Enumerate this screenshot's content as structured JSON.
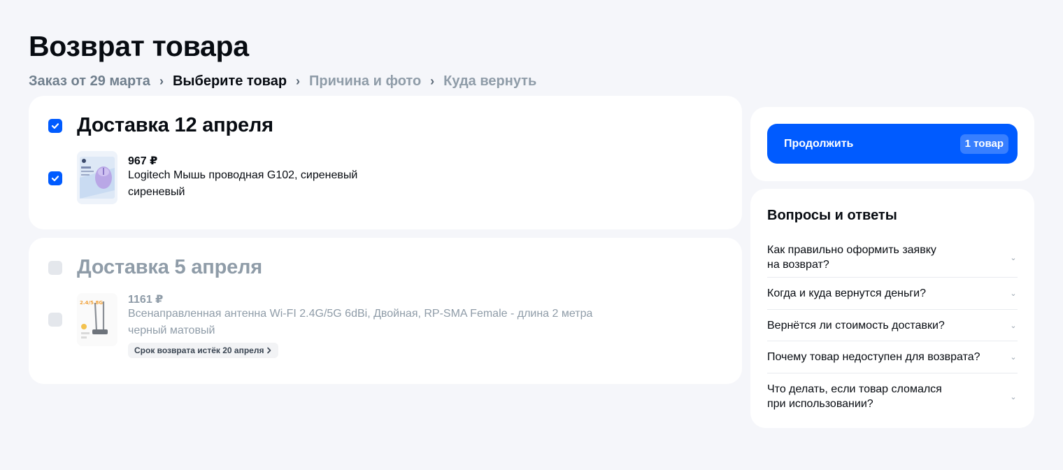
{
  "page": {
    "title": "Возврат товара"
  },
  "breadcrumb": [
    {
      "label": "Заказ от 29 марта",
      "state": "done"
    },
    {
      "label": "Выберите товар",
      "state": "active"
    },
    {
      "label": "Причина и фото",
      "state": "future"
    },
    {
      "label": "Куда вернуть",
      "state": "future"
    }
  ],
  "breadcrumb_separator": "›",
  "groups": [
    {
      "title": "Доставка 12 апреля",
      "checked": true,
      "item": {
        "price": "967 ₽",
        "name": "Logitech Мышь проводная G102, сиреневый",
        "color": "сиреневый",
        "checked": true
      }
    },
    {
      "title": "Доставка 5 апреля",
      "checked": false,
      "item": {
        "price": "1161 ₽",
        "name": "Всенаправленная антенна Wi-FI 2.4G/5G 6dBi, Двойная, RP-SMA Female - длина 2 метра",
        "color": "черный матовый",
        "checked": false,
        "badge": "Срок возврата истёк 20 апреля",
        "thumb_text": "2.4/5.8G"
      }
    }
  ],
  "summary": {
    "continue_label": "Продолжить",
    "count_label": "1 товар"
  },
  "faq": {
    "title": "Вопросы и ответы",
    "items": [
      {
        "question": "Как правильно оформить заявку на возврат?",
        "lines": [
          "Как правильно оформить заявку",
          "на возврат?"
        ]
      },
      {
        "question": "Когда и куда вернутся деньги?",
        "lines": [
          "Когда и куда вернутся деньги?"
        ]
      },
      {
        "question": "Вернётся ли стоимость доставки?",
        "lines": [
          "Вернётся ли стоимость доставки?"
        ]
      },
      {
        "question": "Почему товар недоступен для возврата?",
        "lines": [
          "Почему товар недоступен для возврата?"
        ]
      },
      {
        "question": "Что делать, если товар сломался при использовании?",
        "lines": [
          "Что делать, если товар сломался",
          "при использовании?"
        ]
      }
    ]
  },
  "colors": {
    "accent": "#005bff",
    "background": "#f5f6fa",
    "text_primary": "#070b11",
    "text_muted": "#8f9ca8"
  },
  "icons": {
    "check": "checkmark-icon",
    "chevron_right": "chevron-right-icon",
    "chevron_down": "chevron-down-icon"
  }
}
